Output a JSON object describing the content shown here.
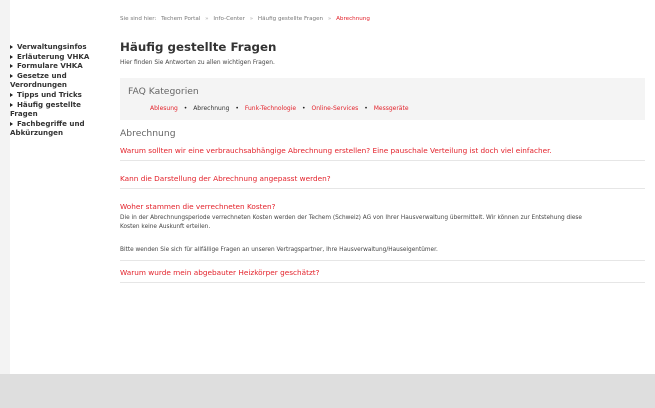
{
  "breadcrumb": {
    "prefix": "Sie sind hier:",
    "items": [
      "Techem Portal",
      "Info-Center",
      "Häufig gestellte Fragen"
    ],
    "current": "Abrechnung",
    "separator": "»"
  },
  "sidebar": {
    "items": [
      {
        "label": "Verwaltungsinfos"
      },
      {
        "label": "Erläuterung VHKA"
      },
      {
        "label": "Formulare VHKA"
      },
      {
        "label": "Gesetze und Verordnungen"
      },
      {
        "label": "Tipps und Tricks"
      },
      {
        "label": "Häufig gestellte Fragen"
      },
      {
        "label": "Fachbegriffe und Abkürzungen"
      }
    ]
  },
  "main": {
    "title": "Häufig gestellte Fragen",
    "intro": "Hier finden Sie Antworten zu allen wichtigen Fragen.",
    "faq": {
      "title": "FAQ Kategorien",
      "categories": [
        "Ablesung",
        "Abrechnung",
        "Funk-Technologie",
        "Online-Services",
        "Messgeräte"
      ]
    },
    "section_title": "Abrechnung",
    "questions": [
      {
        "q": "Warum sollten wir eine verbrauchsabhängige Abrechnung erstellen? Eine pauschale Verteilung ist doch viel einfacher."
      },
      {
        "q": "Kann die Darstellung der Abrechnung angepasst werden?"
      },
      {
        "q": "Woher stammen die verrechneten Kosten?",
        "answer_1": "Die in der Abrechnungsperiode verrechneten Kosten werden der Techem (Schweiz) AG von Ihrer Hausverwaltung übermittelt. Wir können zur Entstehung diese",
        "answer_1b": "Kosten keine Auskunft erteilen.",
        "answer_2": "Bitte wenden Sie sich für allfällige Fragen an unseren Vertragspartner, Ihre Hausverwaltung/Hauseigentümer."
      },
      {
        "q": "Warum wurde mein abgebauter Heizkörper geschätzt?"
      }
    ]
  },
  "colors": {
    "accent": "#e3212a",
    "text": "#333333",
    "faq_bg": "#f4f4f4",
    "footer": "#dedede"
  }
}
